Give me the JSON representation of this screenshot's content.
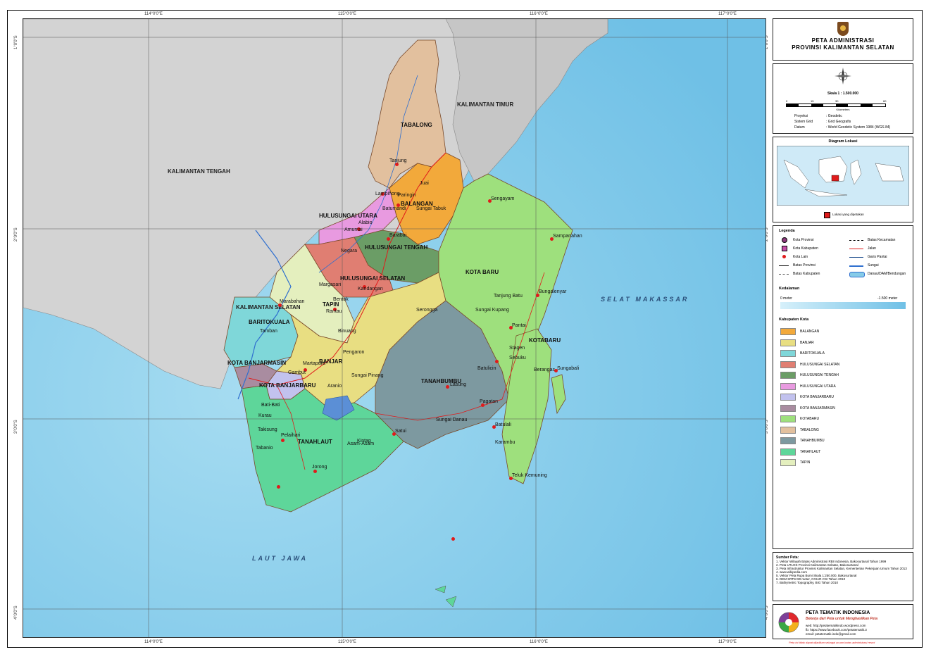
{
  "coords": {
    "top": [
      "114°0'0\"E",
      "115°0'0\"E",
      "116°0'0\"E",
      "117°0'0\"E"
    ],
    "left": [
      "1°0'0\"S",
      "2°0'0\"S",
      "3°0'0\"S",
      "4°0'0\"S"
    ]
  },
  "map": {
    "neighbors": [
      "KALIMANTAN TENGAH",
      "KALIMANTAN TIMUR",
      "KALIMANTAN SELATAN"
    ],
    "seas": [
      "SELAT MAKASSAR",
      "LAUT JAWA"
    ],
    "regions": [
      "TABALONG",
      "BALANGAN",
      "HULUSUNGAI UTARA",
      "HULUSUNGAI TENGAH",
      "HULUSUNGAI SELATAN",
      "TAPIN",
      "BARITOKUALA",
      "BANJAR",
      "KOTA BANJARMASIN",
      "KOTA BANJARBARU",
      "TANAHLAUT",
      "TANAHBUMBU",
      "KOTABARU",
      "KOTA BARU"
    ],
    "towns": [
      "Tanjung",
      "Lampihong",
      "Paringin",
      "Juai",
      "Batumandi",
      "Sungai Tabuk",
      "Barabai",
      "Amuntai",
      "Alabio",
      "Negara",
      "Kandangan",
      "Margasari",
      "Rantau",
      "Binuang",
      "Marabahan",
      "Tamban",
      "Martapura",
      "Pelaihari",
      "Bati-Bati",
      "Takisung",
      "Jorong",
      "Asam-Asam",
      "Kintap",
      "Satui",
      "Batulicin",
      "Pagatan",
      "Sungai Danau",
      "Lasung",
      "Serongga",
      "Sungai Kupang",
      "Pantai",
      "Sampanahan",
      "Sengayam",
      "Bungalenyar",
      "Tanjung Batu",
      "Stagen",
      "Sebuku",
      "Berangas",
      "Sungabali",
      "Teluk Kemuning",
      "Batulali",
      "Karambu",
      "Bentok",
      "Kurau",
      "Tabanio",
      "Aranio",
      "Sungai Pinang",
      "Gambut",
      "Pengaron"
    ]
  },
  "panel": {
    "title1": "PETA ADMINISTRASI",
    "title2": "PROVINSI KALIMANTAN SELATAN",
    "scale": "Skala 1 : 1.500.000",
    "scale_ticks": [
      "0",
      "15",
      "30",
      "60"
    ],
    "scale_unit": "Kilometers",
    "projection": [
      {
        "k": "Proyeksi",
        "v": ": Geodetic"
      },
      {
        "k": "Sistem Grid",
        "v": ": Grid Geografis"
      },
      {
        "k": "Datum",
        "v": ": World Geodetic System 1984 (WGS 84)"
      }
    ],
    "inset_title": "Diagram Lokasi",
    "inset_legend": "Lokasi yang dipetakan",
    "legend_title": "Legenda",
    "legend_items": [
      {
        "label": "Kota Provinsi",
        "type": "prov"
      },
      {
        "label": "Batas Kecamatan",
        "type": "dash"
      },
      {
        "label": "Kota Kabupaten",
        "type": "kab"
      },
      {
        "label": "Jalan",
        "type": "road"
      },
      {
        "label": "Kota Lain",
        "type": "dot"
      },
      {
        "label": "Garis Pantai",
        "type": "coast"
      },
      {
        "label": "Batas Provinsi",
        "type": "line"
      },
      {
        "label": "Sungai",
        "type": "river"
      },
      {
        "label": "Batas Kabupaten",
        "type": "dashdot"
      },
      {
        "label": "Danau/DAM/Bendungan",
        "type": "lake"
      }
    ],
    "depth_title": "Kedalaman",
    "depth_min": "0 meter",
    "depth_max": "-1.500 meter",
    "kab_title": "Kabupaten Kota",
    "kabupaten": [
      {
        "name": "BALANGAN",
        "color": "#f2a93b"
      },
      {
        "name": "BANJAR",
        "color": "#e8de82"
      },
      {
        "name": "BARITOKUALA",
        "color": "#7fd7d9"
      },
      {
        "name": "HULUSUNGAI SELATAN",
        "color": "#e07e72"
      },
      {
        "name": "HULUSUNGAI TENGAH",
        "color": "#6b9d66"
      },
      {
        "name": "HULUSUNGAI UTARA",
        "color": "#e89ae0"
      },
      {
        "name": "KOTA BANJARBARU",
        "color": "#c2c2ee"
      },
      {
        "name": "KOTA BANJARMASIN",
        "color": "#a98ca0"
      },
      {
        "name": "KOTABARU",
        "color": "#9ee07d"
      },
      {
        "name": "TABALONG",
        "color": "#e2c09e"
      },
      {
        "name": "TANAHBUMBU",
        "color": "#7d99a0"
      },
      {
        "name": "TANAHLAUT",
        "color": "#5ed69a"
      },
      {
        "name": "TAPIN",
        "color": "#e4efbe"
      }
    ],
    "source_title": "Sumber Peta:",
    "sources": [
      "1. Vektor Wilayah Batas Administrasi RBI Indonesia, Bakosurtanal Tahun 1999",
      "2. Peta UTLOS Provinsi Kalimantan Selatan, Bakosurtanal",
      "3. Peta Infrastruktur Provinsi Kalimantan Selatan, Kementerian Pekerjaan Umum Tahun 2013",
      "4. www.wikipedia.com",
      "5. Vektor Peta Rupa Bumi Skala 1:250.000, Bakosurtanal",
      "6. DEM SRTM 90 meter, CGIAR-CSI Tahun 2010",
      "7. Bathymetric Topography, BIG Tahun 2010"
    ],
    "logo_title": "PETA TEMATIK INDONESIA",
    "logo_slogan": "Bekerja dari Peta untuk Menghasilkan Peta",
    "logo_web": "web: http://petatematikindo.wordpress.com",
    "logo_fb": "fb: https://www.facebook.com/petatematik.3",
    "logo_email": "email: petatematik.indo@gmail.com",
    "footnote": "Peta ini tidak dapat dijadikan sebagai acuan batas administrasi resmi"
  }
}
